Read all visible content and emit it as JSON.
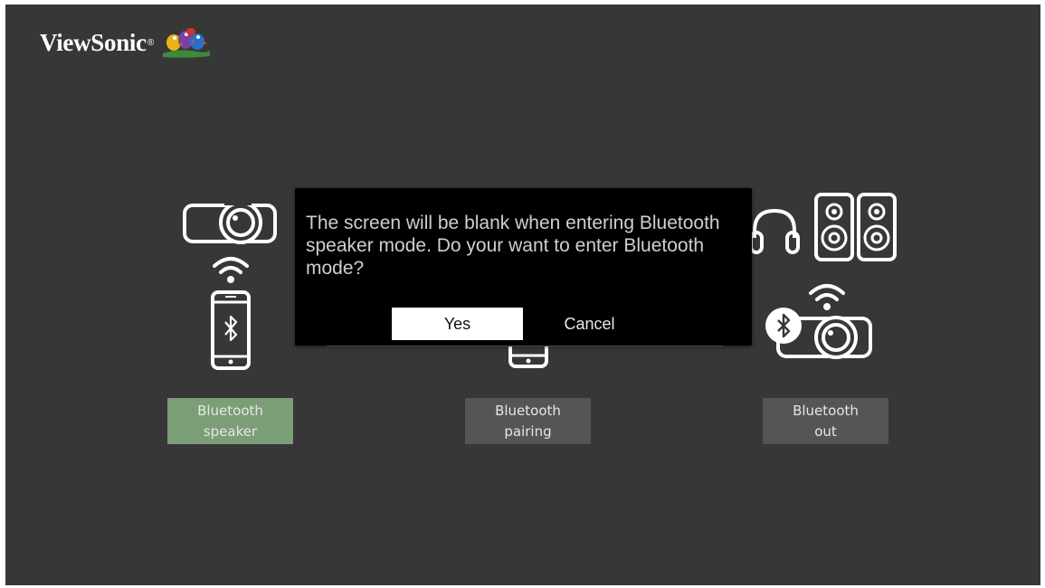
{
  "brand": {
    "name": "ViewSonic",
    "registered": "®"
  },
  "modes": [
    {
      "line1": "Bluetooth",
      "line2": "speaker",
      "selected": true
    },
    {
      "line1": "Bluetooth",
      "line2": "pairing",
      "selected": false
    },
    {
      "line1": "Bluetooth",
      "line2": "out",
      "selected": false
    }
  ],
  "dialog": {
    "message": "The screen will be blank when entering Bluetooth speaker mode. Do your want to enter Bluetooth mode?",
    "yes_label": "Yes",
    "cancel_label": "Cancel"
  },
  "icons": {
    "speaker_mode": [
      "projector-icon",
      "wifi-icon",
      "smartphone-bluetooth-icon"
    ],
    "pairing_mode": [
      "smartphone-icon"
    ],
    "out_mode": [
      "headphones-icon",
      "speakers-icon",
      "wifi-icon",
      "projector-bluetooth-icon"
    ]
  },
  "colors": {
    "background": "#373737",
    "selected_button": "#7b9e76",
    "button": "#555555",
    "dialog": "#000000"
  }
}
